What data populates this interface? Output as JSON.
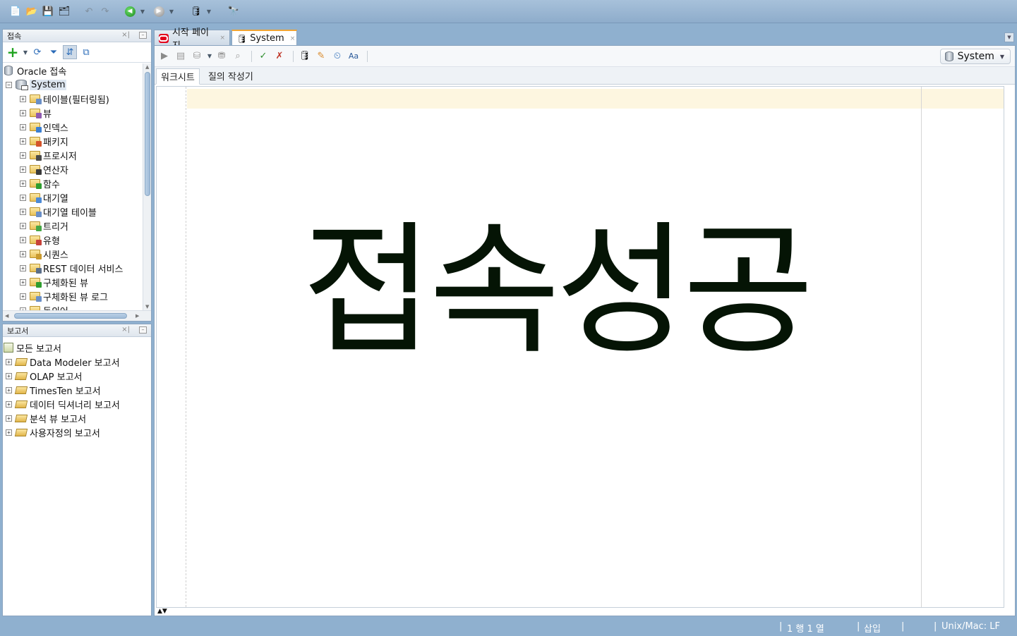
{
  "toolbar": {
    "icons": [
      "new-icon",
      "open-icon",
      "save-icon",
      "save-all-icon",
      "undo-icon",
      "redo-icon",
      "back-icon",
      "forward-icon",
      "sql-worksheet-icon",
      "find-icon"
    ]
  },
  "connections_panel": {
    "title": "접속",
    "tree_root": {
      "label": "Oracle 접속"
    },
    "connection": {
      "label": "System"
    },
    "nodes": [
      {
        "label": "테이블(필터링됨)",
        "badge_color": "#6a8fc7"
      },
      {
        "label": "뷰",
        "badge_color": "#8f5bb0"
      },
      {
        "label": "인덱스",
        "badge_color": "#3c7fd1"
      },
      {
        "label": "패키지",
        "badge_color": "#d4542b"
      },
      {
        "label": "프로시저",
        "badge_color": "#4a4a4a"
      },
      {
        "label": "연산자",
        "badge_color": "#3a3a3a"
      },
      {
        "label": "함수",
        "badge_color": "#2f9d2f"
      },
      {
        "label": "대기열",
        "badge_color": "#4d8ad6"
      },
      {
        "label": "대기열 테이블",
        "badge_color": "#6a8fc7"
      },
      {
        "label": "트리거",
        "badge_color": "#46a646"
      },
      {
        "label": "유형",
        "badge_color": "#c7423a"
      },
      {
        "label": "시퀀스",
        "badge_color": "#c99a2e"
      },
      {
        "label": "REST 데이터 서비스",
        "badge_color": "#5b6f8a"
      },
      {
        "label": "구체화된 뷰",
        "badge_color": "#2f9d2f"
      },
      {
        "label": "구체화된 뷰 로그",
        "badge_color": "#6a8fc7"
      },
      {
        "label": "동의어",
        "badge_color": "#6a8fc7"
      }
    ]
  },
  "reports_panel": {
    "title": "보고서",
    "root": {
      "label": "모든 보고서"
    },
    "items": [
      {
        "label": "Data Modeler 보고서"
      },
      {
        "label": "OLAP 보고서"
      },
      {
        "label": "TimesTen 보고서"
      },
      {
        "label": "데이터 딕셔너리 보고서"
      },
      {
        "label": "분석 뷰 보고서"
      },
      {
        "label": "사용자정의 보고서"
      }
    ]
  },
  "editor": {
    "tabs": [
      {
        "label": "시작 페이지",
        "close": "×"
      },
      {
        "label": "System",
        "close": "×"
      }
    ],
    "connection_selector": "System",
    "sub_tabs": [
      "워크시트",
      "질의 작성기"
    ],
    "content_text": "접속성공"
  },
  "status_bar": {
    "position": "1 행 1 열",
    "mode": "삽입",
    "line_ending": "Unix/Mac: LF"
  },
  "colors": {
    "accent_tab": "#f2a533",
    "chrome_blue": "#8fb0cf",
    "current_line": "#fdf6e0",
    "content_text": "#051405"
  }
}
